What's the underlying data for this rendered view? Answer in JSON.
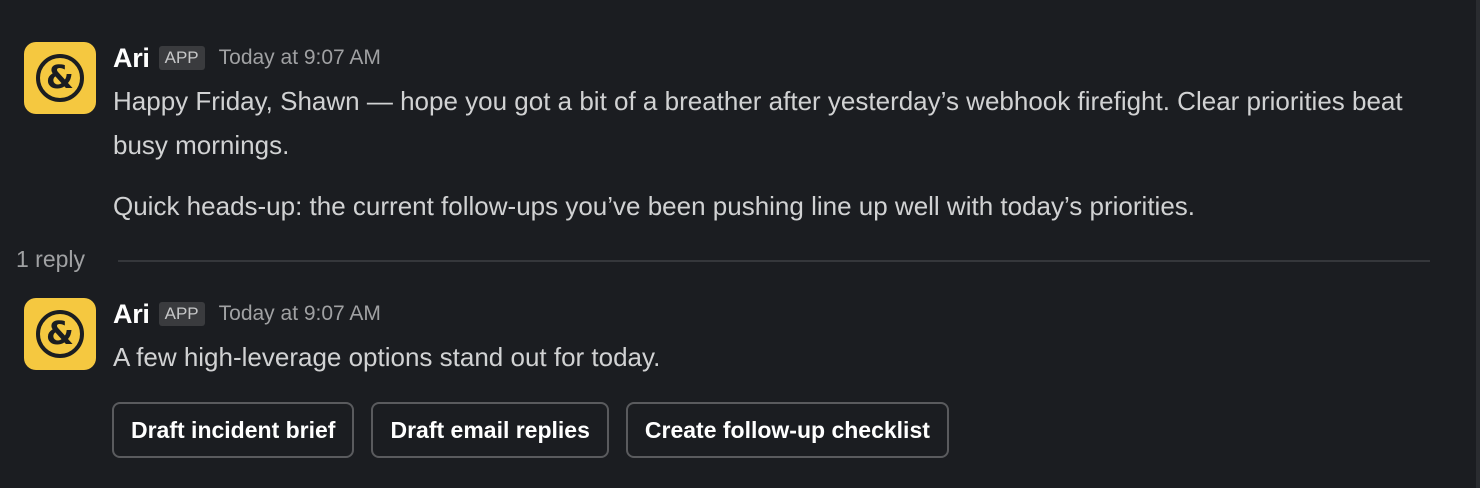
{
  "messages": [
    {
      "sender": "Ari",
      "badge": "APP",
      "timestamp": "Today at 9:07 AM",
      "avatar_icon": "ampersand-logo-icon",
      "paragraphs": [
        "Happy Friday, Shawn — hope you got a bit of a breather after yesterday’s webhook firefight. Clear priorities beat busy mornings.",
        "Quick heads-up: the current follow-ups you’ve been pushing line up well with today’s priorities."
      ]
    },
    {
      "sender": "Ari",
      "badge": "APP",
      "timestamp": "Today at 9:07 AM",
      "avatar_icon": "ampersand-logo-icon",
      "paragraphs": [
        "A few high-leverage options stand out for today."
      ]
    }
  ],
  "thread": {
    "reply_count": "1 reply"
  },
  "actions": [
    {
      "label": "Draft incident brief"
    },
    {
      "label": "Draft email replies"
    },
    {
      "label": "Create follow-up checklist"
    }
  ],
  "colors": {
    "background": "#1b1d21",
    "avatar_bg": "#f5c840",
    "text": "#d1d2d3",
    "muted": "#a0a1a3"
  }
}
